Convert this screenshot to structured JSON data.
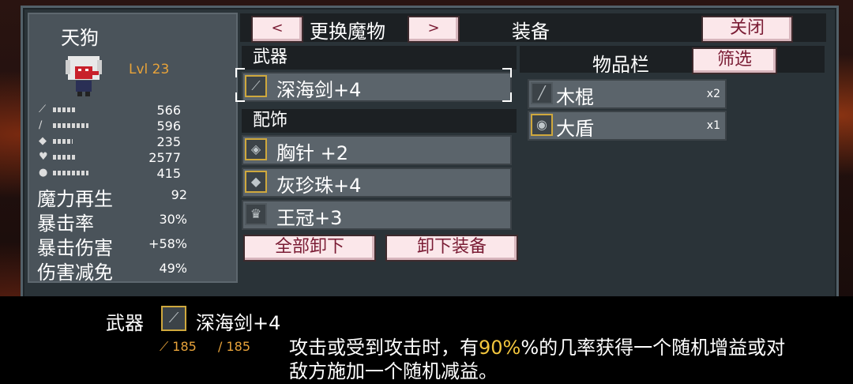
{
  "monster": {
    "name": "天狗",
    "level": "Lvl 23",
    "stats": [
      {
        "icon": "sword-icon",
        "value": "566",
        "bar": 0.3
      },
      {
        "icon": "staff-icon",
        "value": "596",
        "bar": 0.45
      },
      {
        "icon": "shield-icon",
        "value": "235",
        "bar": 0.25
      },
      {
        "icon": "heart-icon",
        "value": "2577",
        "bar": 0.3
      },
      {
        "icon": "mana-icon",
        "value": "415",
        "bar": 0.45
      }
    ],
    "attributes": [
      {
        "label": "魔力再生",
        "value": "92"
      },
      {
        "label": "暴击率",
        "value": "30%"
      },
      {
        "label": "暴击伤害",
        "value": "+58%"
      },
      {
        "label": "伤害减免",
        "value": "49%"
      }
    ]
  },
  "header": {
    "prev_label": "<",
    "title": "更换魔物",
    "next_label": ">",
    "equip_label": "装备",
    "close_label": "关闭"
  },
  "weapon": {
    "section_label": "武器",
    "item": {
      "name": "深海剑+4",
      "icon": "blade-icon"
    }
  },
  "accessory": {
    "section_label": "配饰",
    "items": [
      {
        "name": "胸针 +2",
        "icon": "brooch-icon"
      },
      {
        "name": "灰珍珠+4",
        "icon": "pearl-icon"
      },
      {
        "name": "王冠+3",
        "icon": "crown-icon"
      }
    ]
  },
  "actions": {
    "unequip_all": "全部卸下",
    "unequip": "卸下装备"
  },
  "inventory": {
    "label": "物品栏",
    "filter_label": "筛选",
    "items": [
      {
        "name": "木棍",
        "qty": "x2",
        "icon": "stick-icon"
      },
      {
        "name": "大盾",
        "qty": "x1",
        "icon": "big-shield-icon"
      }
    ]
  },
  "info": {
    "category": "武器",
    "item_name": "深海剑+4",
    "stat1": "185",
    "stat2": "185",
    "desc_pre": "攻击或受到攻击时，有",
    "desc_pct": "90%",
    "desc_post": "%的几率获得一个随机增益或对敌方施加一个随机减益。"
  },
  "colors": {
    "gold": "#e8a33a",
    "button_bg": "#fbe7ea",
    "button_text": "#7a1c34",
    "highlight": "#f2c53d"
  }
}
